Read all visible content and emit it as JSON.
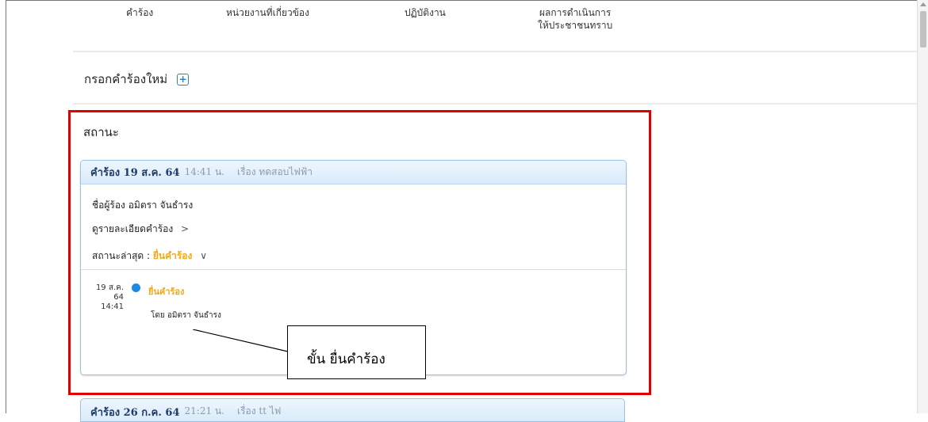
{
  "nav": {
    "items": [
      "คำร้อง",
      "หน่วยงานที่เกี่ยวข้อง",
      "ปฏิบัติงาน"
    ],
    "results_line1": "ผลการดำเนินการ",
    "results_line2": "ให้ประชาชนทราบ"
  },
  "new_request": {
    "label": "กรอกคำร้องใหม่",
    "plus_icon": "+"
  },
  "status_section": {
    "title": "สถานะ",
    "card": {
      "title": "คำร้อง 19 ส.ค. 64",
      "time": "14:41 น.",
      "subject": "เรื่อง ทดสอบไฟฟ้า",
      "petitioner": "ชื่อผู้ร้อง อมิตรา จันธำรง",
      "details_link": "ดูรายละเอียดคำร้อง",
      "details_chevron": ">",
      "latest_status_label": "สถานะล่าสุด : ",
      "latest_status_value": "ยื่นคำร้อง",
      "status_chevron": "∨",
      "timeline": {
        "date": "19 ส.ค. 64",
        "time": "14:41",
        "label": "ยื่นคำร้อง",
        "by": "โดย อมิตรา จันธำรง"
      }
    },
    "card2": {
      "title": "คำร้อง 26 ก.ค. 64",
      "time": "21:21 น.",
      "subject": "เรื่อง tt ไฟ"
    }
  },
  "callout": {
    "text": "ขั้น ยื่นคำร้อง"
  },
  "colors": {
    "accent_blue": "#1e88e5",
    "status_orange": "#f0a81c",
    "highlight_red": "#e00000"
  }
}
